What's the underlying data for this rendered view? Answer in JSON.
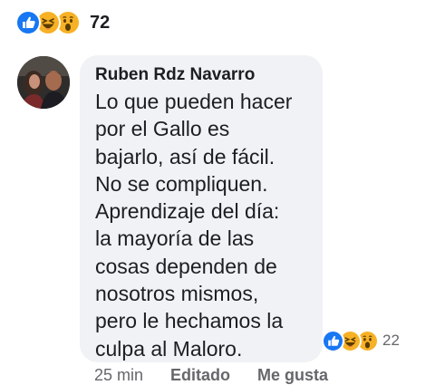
{
  "reactions_summary": {
    "icons": [
      "like-icon",
      "haha-icon",
      "wow-icon"
    ],
    "count": "72"
  },
  "comment": {
    "author": "Ruben Rdz Navarro",
    "lines": [
      "Lo que pueden hacer",
      "por el Gallo es",
      "bajarlo, así de fácil.",
      "No se compliquen.",
      "Aprendizaje del día:",
      "la mayoría de las",
      "cosas dependen de",
      "nosotros mismos,",
      "pero le hechamos la",
      "culpa al Maloro."
    ],
    "reactions": {
      "icons": [
        "like-icon",
        "haha-icon",
        "wow-icon"
      ],
      "count": "22"
    }
  },
  "actions": {
    "timestamp": "25 min",
    "edited_label": "Editado",
    "like_label": "Me gusta"
  },
  "colors": {
    "like_blue": "#1877f2",
    "emoji_yellow": "#f7b125",
    "bubble_bg": "#f0f2f5",
    "secondary_text": "#65676b"
  }
}
